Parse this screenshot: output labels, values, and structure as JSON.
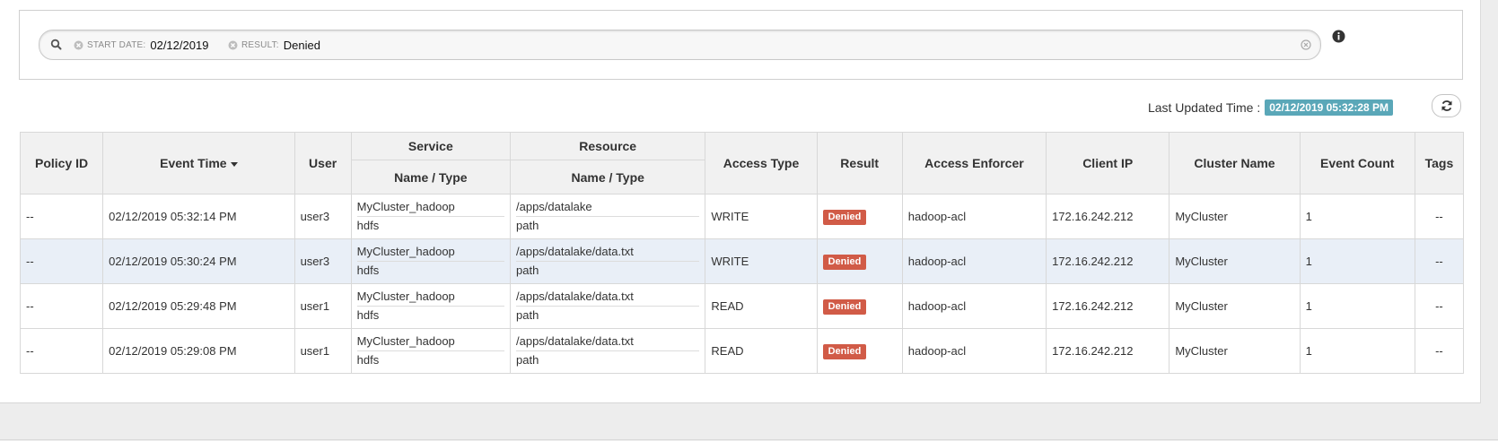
{
  "search": {
    "facets": [
      {
        "label": "START DATE:",
        "value": "02/12/2019"
      },
      {
        "label": "RESULT:",
        "value": "Denied"
      }
    ]
  },
  "last_updated": {
    "label": "Last Updated Time :",
    "value": "02/12/2019 05:32:28 PM"
  },
  "table": {
    "group_headers": {
      "service": "Service",
      "resource": "Resource"
    },
    "headers": {
      "policy_id": "Policy ID",
      "event_time": "Event Time",
      "user": "User",
      "service_name_type": "Name / Type",
      "resource_name_type": "Name / Type",
      "access_type": "Access Type",
      "result": "Result",
      "access_enforcer": "Access Enforcer",
      "client_ip": "Client IP",
      "cluster_name": "Cluster Name",
      "event_count": "Event Count",
      "tags": "Tags"
    },
    "rows": [
      {
        "policy_id": "--",
        "event_time": "02/12/2019 05:32:14 PM",
        "user": "user3",
        "service_name": "MyCluster_hadoop",
        "service_type": "hdfs",
        "resource_name": "/apps/datalake",
        "resource_type": "path",
        "access_type": "WRITE",
        "result": "Denied",
        "access_enforcer": "hadoop-acl",
        "client_ip": "172.16.242.212",
        "cluster_name": "MyCluster",
        "event_count": "1",
        "tags": "--"
      },
      {
        "policy_id": "--",
        "event_time": "02/12/2019 05:30:24 PM",
        "user": "user3",
        "service_name": "MyCluster_hadoop",
        "service_type": "hdfs",
        "resource_name": "/apps/datalake/data.txt",
        "resource_type": "path",
        "access_type": "WRITE",
        "result": "Denied",
        "access_enforcer": "hadoop-acl",
        "client_ip": "172.16.242.212",
        "cluster_name": "MyCluster",
        "event_count": "1",
        "tags": "--"
      },
      {
        "policy_id": "--",
        "event_time": "02/12/2019 05:29:48 PM",
        "user": "user1",
        "service_name": "MyCluster_hadoop",
        "service_type": "hdfs",
        "resource_name": "/apps/datalake/data.txt",
        "resource_type": "path",
        "access_type": "READ",
        "result": "Denied",
        "access_enforcer": "hadoop-acl",
        "client_ip": "172.16.242.212",
        "cluster_name": "MyCluster",
        "event_count": "1",
        "tags": "--"
      },
      {
        "policy_id": "--",
        "event_time": "02/12/2019 05:29:08 PM",
        "user": "user1",
        "service_name": "MyCluster_hadoop",
        "service_type": "hdfs",
        "resource_name": "/apps/datalake/data.txt",
        "resource_type": "path",
        "access_type": "READ",
        "result": "Denied",
        "access_enforcer": "hadoop-acl",
        "client_ip": "172.16.242.212",
        "cluster_name": "MyCluster",
        "event_count": "1",
        "tags": "--"
      }
    ]
  },
  "icons": {
    "search": "search-icon",
    "facet_remove": "close-circle-icon",
    "clear": "clear-circle-icon",
    "info": "info-icon",
    "refresh": "refresh-icon",
    "sort": "sort-down-icon"
  },
  "colors": {
    "denied_badge": "#d15b47",
    "timestamp_badge": "#5aa7b8",
    "highlight_row": "#e9eff7"
  }
}
